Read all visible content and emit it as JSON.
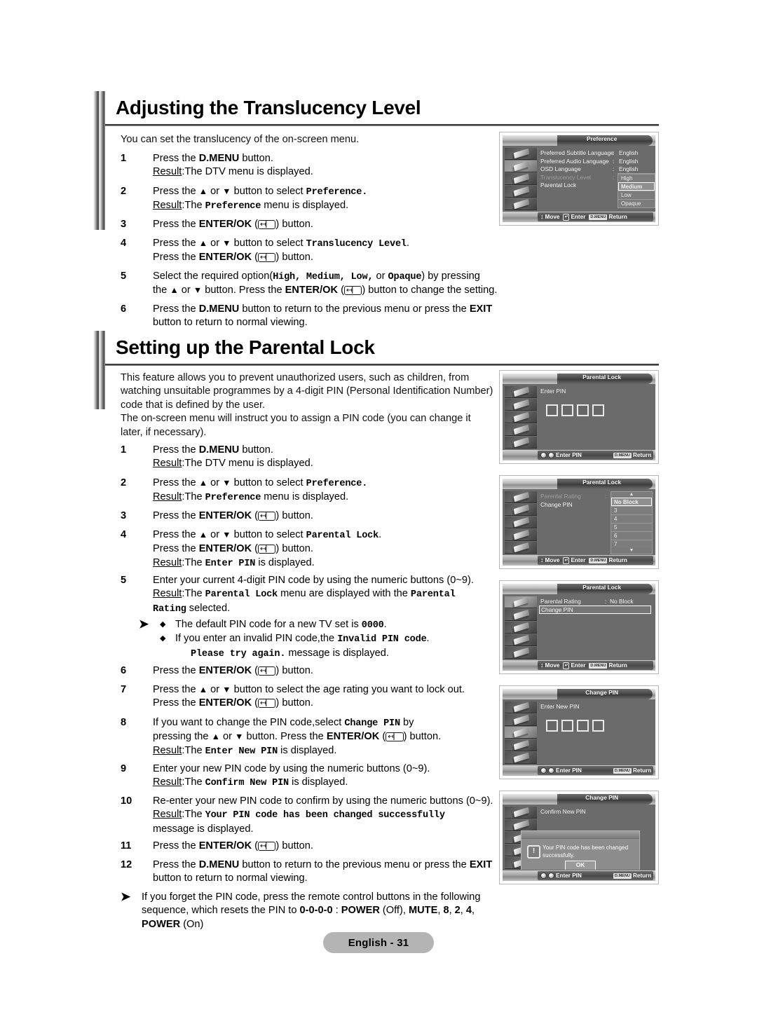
{
  "sections": [
    {
      "title": "Adjusting the Translucency Level",
      "intro": "You can set the translucency of the on-screen menu.",
      "steps": [
        {
          "num": "1",
          "lines": [
            "Press the <b>D.MENU</b> button.",
            "<span class=\"res\">Result</span>:The DTV menu is displayed."
          ]
        },
        {
          "num": "2",
          "lines": [
            "Press the <span class=\"arr\">&#9650;</span> or <span class=\"arr\">&#9660;</span> button to select <span class=\"mono\">Preference.</span>",
            "<span class=\"res\">Result</span>:The <span class=\"mono\">Preference</span> menu is displayed."
          ]
        },
        {
          "num": "3",
          "lines": [
            "Press the <b>ENTER/OK</b> (<span class=\"ent\">&#8612;&#9144;</span>) button."
          ]
        },
        {
          "num": "4",
          "lines": [
            "Press the <span class=\"arr\">&#9650;</span> or <span class=\"arr\">&#9660;</span> button to select <span class=\"mono\">Translucency Level</span>.",
            "Press the <b>ENTER/OK</b> (<span class=\"ent\">&#8612;&#9144;</span>) button."
          ]
        },
        {
          "num": "5",
          "lines": [
            "Select the required option(<span class=\"mono\">High, Medium, Low,</span> or <span class=\"mono\">Opaque</span>) by pressing",
            "the <span class=\"arr\">&#9650;</span> or <span class=\"arr\">&#9660;</span> button. Press the <b>ENTER/OK</b> (<span class=\"ent\">&#8612;&#9144;</span>) button to change the setting."
          ]
        },
        {
          "num": "6",
          "lines": [
            "Press the <b>D.MENU</b> button to return to the previous menu or press the <b>EXIT</b>",
            "button to return to normal viewing."
          ]
        }
      ]
    },
    {
      "title": "Setting up the Parental Lock",
      "intro_lines": [
        "This feature allows you to prevent unauthorized users, such as children, from",
        "watching unsuitable programmes by a 4-digit PIN (Personal Identification Number)",
        "code that is defined by the user.",
        "The on-screen menu will instruct you to assign a PIN code (you can change it",
        "later, if necessary)."
      ],
      "steps": [
        {
          "num": "1",
          "lines": [
            "Press the <b>D.MENU</b> button.",
            "<span class=\"res\">Result</span>:The DTV menu is displayed."
          ]
        },
        {
          "num": "2",
          "lines": [
            "Press the <span class=\"arr\">&#9650;</span> or <span class=\"arr\">&#9660;</span> button to select <span class=\"mono\">Preference.</span>",
            "<span class=\"res\">Result</span>:The <span class=\"mono\">Preference</span> menu is displayed."
          ]
        },
        {
          "num": "3",
          "lines": [
            "Press the <b>ENTER/OK</b> (<span class=\"ent\">&#8612;&#9144;</span>) button."
          ]
        },
        {
          "num": "4",
          "lines": [
            "Press the <span class=\"arr\">&#9650;</span> or <span class=\"arr\">&#9660;</span> button to select <span class=\"mono\">Parental Lock</span>.",
            "Press the <b>ENTER/OK</b> (<span class=\"ent\">&#8612;&#9144;</span>) button.",
            "<span class=\"res\">Result</span>:The <span class=\"mono\">Enter PIN</span> is displayed."
          ]
        },
        {
          "num": "5",
          "lines": [
            "Enter your current 4-digit PIN code by using the numeric buttons (0~9).",
            "<span class=\"res\">Result</span>:The <span class=\"mono\">Parental Lock</span> menu are displayed with the <span class=\"mono\">Parental</span>",
            "<span class=\"mono\">Rating</span> selected."
          ]
        },
        {
          "num": "6",
          "lines": [
            "Press the <b>ENTER/OK</b> (<span class=\"ent\">&#8612;&#9144;</span>) button."
          ]
        },
        {
          "num": "7",
          "lines": [
            "Press the <span class=\"arr\">&#9650;</span> or <span class=\"arr\">&#9660;</span> button to select the age rating you want to lock out.",
            "Press the <b>ENTER/OK</b> (<span class=\"ent\">&#8612;&#9144;</span>) button."
          ]
        },
        {
          "num": "8",
          "lines": [
            "If you want to change the PIN code,select <span class=\"mono\">Change PIN</span> by",
            "pressing the <span class=\"arr\">&#9650;</span> or <span class=\"arr\">&#9660;</span> button. Press the <b>ENTER/OK</b> (<span class=\"ent\">&#8612;&#9144;</span>) button.",
            "<span class=\"res\">Result</span>:The <span class=\"mono\">Enter New PIN</span> is displayed."
          ]
        },
        {
          "num": "9",
          "lines": [
            "Enter your new PIN code by using the numeric buttons (0~9).",
            "<span class=\"res\">Result</span>:The <span class=\"mono\">Confirm New PIN</span> is displayed."
          ]
        },
        {
          "num": "10",
          "lines": [
            "Re-enter your new PIN code to confirm by using the numeric buttons (0~9).",
            "<span class=\"res\">Result</span>:The <span class=\"mono\">Your PIN code has been changed successfully</span>",
            "message is displayed."
          ]
        },
        {
          "num": "11",
          "lines": [
            "Press the <b>ENTER/OK</b> (<span class=\"ent\">&#8612;&#9144;</span>) button."
          ]
        },
        {
          "num": "12",
          "lines": [
            "Press the <b>D.MENU</b> button to return to the previous menu or press the <b>EXIT</b>",
            "button to return to normal viewing."
          ]
        }
      ]
    }
  ],
  "notes": {
    "pin_note_lines": [
      "The default PIN code for a new TV set is <span class=\"mono\">0000</span>.",
      "If you enter an invalid PIN code,the <span class=\"mono\">Invalid PIN code</span>.",
      "<span class=\"mono\">Please try again.</span> message is displayed."
    ],
    "forget_note_lines": [
      "If you forget the PIN code, press the remote control buttons in the following",
      "sequence, which resets the PIN to <b>0-0-0-0</b> : <b>POWER</b> (Off), <b>MUTE</b>, <b>8</b>, <b>2</b>, <b>4</b>,",
      "<b>POWER</b> (On)"
    ]
  },
  "osd_screens": [
    {
      "id": "preference",
      "title": "Preference",
      "rows": [
        {
          "label": "Preferred Subtitle Language",
          "colon": ":",
          "value": "English",
          "dim": false
        },
        {
          "label": "Preferred Audio Language",
          "colon": ":",
          "value": "English",
          "dim": false
        },
        {
          "label": "OSD Language",
          "colon": ":",
          "value": "English",
          "dim": false
        },
        {
          "label": "Translucency Level",
          "colon": ":",
          "value": "",
          "dim": true
        },
        {
          "label": "Parental Lock",
          "colon": "",
          "value": "",
          "dim": false
        }
      ],
      "dropdown": {
        "options": [
          "High",
          "Medium",
          "Low",
          "Opaque"
        ],
        "selected": "Medium"
      },
      "nav": [
        {
          "icon": "updown-arrow-icon",
          "label": "Move"
        },
        {
          "icon": "enter-key-icon",
          "label": "Enter"
        },
        {
          "icon": "dmenu-key-icon",
          "label": "Return"
        }
      ]
    },
    {
      "id": "parental-lock-enter-pin",
      "title": "Parental Lock",
      "heading": "Enter PIN",
      "pin_boxes": 4,
      "nav": [
        {
          "icon": "numeric-keys-icon",
          "label": "Enter PIN"
        },
        {
          "icon": "dmenu-key-icon",
          "label": "Return"
        }
      ]
    },
    {
      "id": "parental-lock-rating",
      "title": "Parental Lock",
      "rows": [
        {
          "label": "Parental Rating",
          "colon": ":",
          "value": ""
        },
        {
          "label": "Change PIN",
          "colon": "",
          "value": ""
        }
      ],
      "dropdown": {
        "options": [
          "No Block",
          "3",
          "4",
          "5",
          "6",
          "7"
        ],
        "selected": "No Block",
        "scroll_up": "▲",
        "scroll_down": "▼"
      },
      "nav": [
        {
          "icon": "updown-arrow-icon",
          "label": "Move"
        },
        {
          "icon": "enter-key-icon",
          "label": "Enter"
        },
        {
          "icon": "dmenu-key-icon",
          "label": "Return"
        }
      ]
    },
    {
      "id": "parental-lock-change-pin",
      "title": "Parental Lock",
      "rows": [
        {
          "label": "Parental Rating",
          "colon": ":",
          "value": "No Block"
        },
        {
          "label": "Change PIN",
          "colon": "",
          "value": ""
        }
      ],
      "highlight_row": "Change PIN",
      "nav": [
        {
          "icon": "updown-arrow-icon",
          "label": "Move"
        },
        {
          "icon": "enter-key-icon",
          "label": "Enter"
        },
        {
          "icon": "dmenu-key-icon",
          "label": "Return"
        }
      ]
    },
    {
      "id": "change-pin-enter-new",
      "title": "Change PIN",
      "heading": "Enter New PIN",
      "pin_boxes": 4,
      "nav": [
        {
          "icon": "numeric-keys-icon",
          "label": "Enter PIN"
        },
        {
          "icon": "dmenu-key-icon",
          "label": "Return"
        }
      ]
    },
    {
      "id": "change-pin-confirm",
      "title": "Change PIN",
      "heading": "Confirm New PIN",
      "dialog": {
        "icon": "!",
        "message_lines": [
          "Your PIN code has been changed",
          "successfully."
        ],
        "ok_label": "OK"
      },
      "nav": [
        {
          "icon": "numeric-keys-icon",
          "label": "Enter PIN"
        },
        {
          "icon": "dmenu-key-icon",
          "label": "Return"
        }
      ]
    }
  ],
  "footer": {
    "label": "English - 31"
  }
}
